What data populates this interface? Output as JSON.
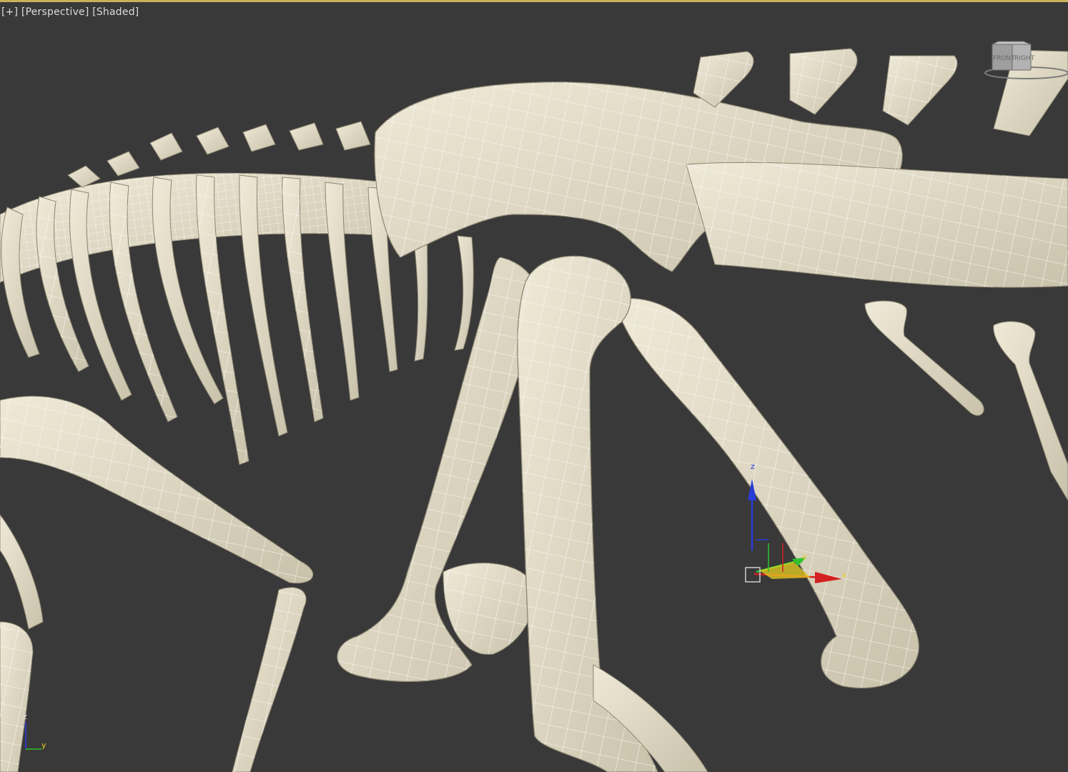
{
  "viewport": {
    "label_menu": "[+]",
    "label_view": "[Perspective]",
    "label_shading": "[Shaded]",
    "active_border_color": "#c8b15a",
    "background_color": "#393939"
  },
  "viewcube": {
    "face_front": "FRONT",
    "face_right": "RIGHT"
  },
  "gizmo": {
    "x_label": "x",
    "y_label": "y",
    "z_label": "z",
    "x_color": "#d42020",
    "y_color": "#2fc22f",
    "z_color": "#2a3cd8",
    "plane_color": "#e8d020"
  },
  "world_axis": {
    "x_label": "x",
    "y_label": "y",
    "z_label": "z"
  },
  "model": {
    "bone_color": "#e3ddca",
    "wire_color": "#ffffff"
  }
}
